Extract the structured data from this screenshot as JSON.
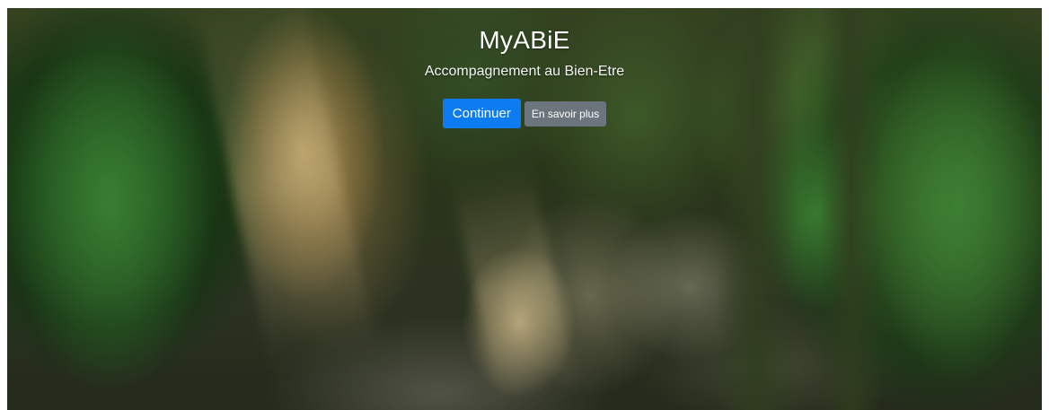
{
  "hero": {
    "title": "MyABiE",
    "subtitle": "Accompagnement au Bien-Etre",
    "primary_label": "Continuer",
    "secondary_label": "En savoir plus"
  },
  "background": {
    "description_icon": "forest-background-image"
  },
  "colors": {
    "primary_button": "#0d7cf2",
    "secondary_button": "#6c757d",
    "text": "#ffffff"
  }
}
